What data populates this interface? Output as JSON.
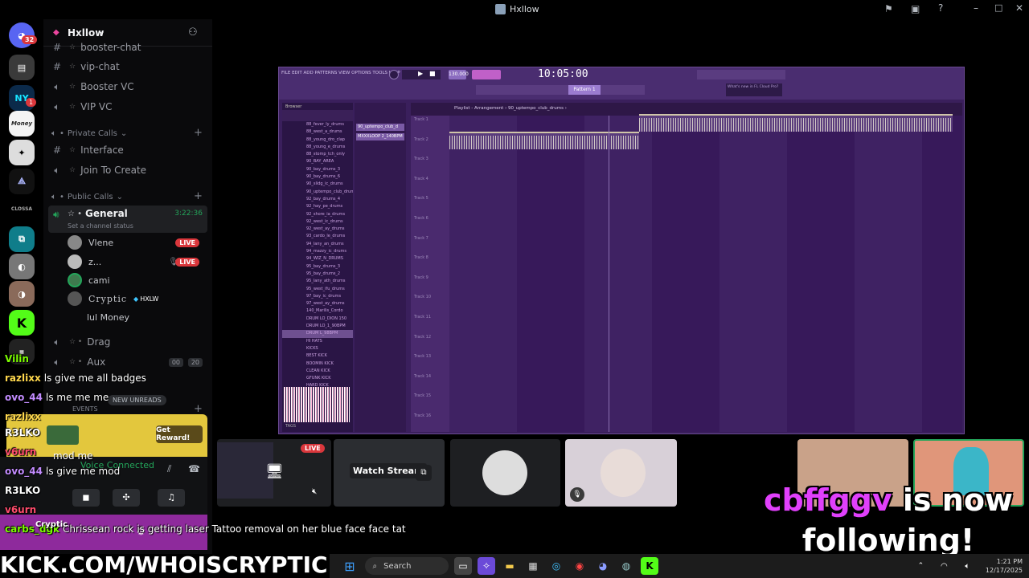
{
  "window": {
    "title": "Hxllow"
  },
  "servers": [
    {
      "name": "discord-home",
      "badge": "32"
    },
    {
      "name": "server-2",
      "badge": ""
    },
    {
      "name": "NY",
      "badge": "1"
    },
    {
      "name": "Money",
      "badge": ""
    },
    {
      "name": "server-5",
      "badge": ""
    },
    {
      "name": "server-6",
      "badge": ""
    },
    {
      "name": "CLOSSA",
      "badge": ""
    }
  ],
  "sidebar": {
    "server_name": "Hxllow",
    "channels_top": [
      {
        "label": "booster-chat",
        "type": "text"
      },
      {
        "label": "vip-chat",
        "type": "text"
      },
      {
        "label": "Booster VC",
        "type": "voice"
      },
      {
        "label": "VIP VC",
        "type": "voice"
      }
    ],
    "private_calls": {
      "label": "Private Calls",
      "items": [
        {
          "label": "Interface",
          "type": "text"
        },
        {
          "label": "Join To Create",
          "type": "voice"
        }
      ]
    },
    "public_calls": {
      "label": "Public Calls",
      "general": {
        "label": "General",
        "time": "3:22:36",
        "status": "Set a channel status"
      },
      "users": [
        {
          "name": "Vlene",
          "live": "LIVE"
        },
        {
          "name": "z...",
          "live": "LIVE"
        },
        {
          "name": "cami",
          "live": ""
        },
        {
          "name": "Cryptic",
          "tag": "HXLW",
          "live": ""
        },
        {
          "name": "lul Money",
          "live": ""
        }
      ],
      "drag": "Drag",
      "aux": {
        "label": "Aux",
        "count1": "00",
        "count2": "20"
      }
    },
    "events_label": "EVENTS",
    "new_unreads": "NEW UNREADS",
    "reward_button": "Get Reward!",
    "voice_connected": "Voice Connected"
  },
  "fl": {
    "menus": "FILE EDIT ADD PATTERNS VIEW OPTIONS TOOLS HELP",
    "time": "10:05:00",
    "bpm": "130.000",
    "pattern": "Pattern 1",
    "playlist_title": "Playlist - Arrangement › 90_uptempo_club_drums ›",
    "browser_label": "Browser",
    "channel1": "90_uptempo_club_d",
    "channel2": "MXXXLOOP 2_140BPM",
    "news": "What's new in FL Cloud Pro?",
    "tracks": [
      "Track 1",
      "Track 2",
      "Track 3",
      "Track 4",
      "Track 5",
      "Track 6",
      "Track 7",
      "Track 8",
      "Track 9",
      "Track 10",
      "Track 11",
      "Track 12",
      "Track 13",
      "Track 14",
      "Track 15",
      "Track 16"
    ],
    "browser_items": [
      "88_fever_ly_drums",
      "88_west_a_drums",
      "88_young_dro_clap",
      "88_young_e_drums",
      "88_stomp_tch_only",
      "90_BAY_AREA",
      "90_bay_drums_3",
      "90_bay_drums_6",
      "90_slidg_ic_drums",
      "90_uptempo_club_drums",
      "92_bay_drums_4",
      "92_hay_pe_drums",
      "92_shore_ia_drums",
      "92_west_ic_drums",
      "92_west_ay_drums",
      "93_cardo_le_drums",
      "94_lany_an_drums",
      "94_mazzy_ic_drums",
      "94_WIZ_N_DRUMS",
      "95_bay_drums_3",
      "95_bay_drums_2",
      "95_lany_ath_drums",
      "95_west_ifu_drums",
      "97_bay_ic_drums",
      "97_west_ay_drums",
      "140_Marilis_Cordo",
      "DRUM LO_DION 150",
      "DRUM LO_1_90BPM",
      "DRUM L_98BPM",
      "HI HATS",
      "KICKS",
      "BEST KICK",
      "BOOMIN KICK",
      "CLEAN KICK",
      "GFUNK KICK",
      "HARD KICK"
    ],
    "tags_label": "TAGS"
  },
  "streams": {
    "live": "LIVE",
    "watch": "Watch Stream"
  },
  "chat": [
    {
      "user": "Vilin",
      "text": "",
      "color": "#7CFC00"
    },
    {
      "user": "razlixx",
      "text": "ls give me all badges",
      "color": "#ffd84d"
    },
    {
      "user": "ovo_44",
      "text": "ls me me me",
      "color": "#c38cff"
    },
    {
      "user": "razlixx",
      "text": "",
      "color": "#ffd84d"
    },
    {
      "user": "R3LKO",
      "text": "",
      "color": "#ffffff"
    },
    {
      "user": "v6urn",
      "text": "",
      "color": "#ff4d6d"
    },
    {
      "user": "ovo_44",
      "text": "ls give me mod",
      "color": "#c38cff"
    },
    {
      "user": "R3LKO",
      "text": "",
      "color": "#ffffff"
    },
    {
      "user": "v6urn",
      "text": "",
      "color": "#ff4d6d"
    },
    {
      "user": "carbs_dgk",
      "text": "Chrissean rock is getting laser Tattoo removal on her blue face face tat",
      "color": "#7CFC00"
    }
  ],
  "chat_extras": {
    "mod_me": "mod me",
    "cryptic": "Cryptic"
  },
  "follow": {
    "name": "cbffggv",
    "text1": "is now",
    "text2": "following!"
  },
  "banner": "KICK.COM/WHOISCRYPTIC",
  "taskbar": {
    "search": "Search",
    "time": "1:21 PM",
    "date": "12/17/2025"
  }
}
